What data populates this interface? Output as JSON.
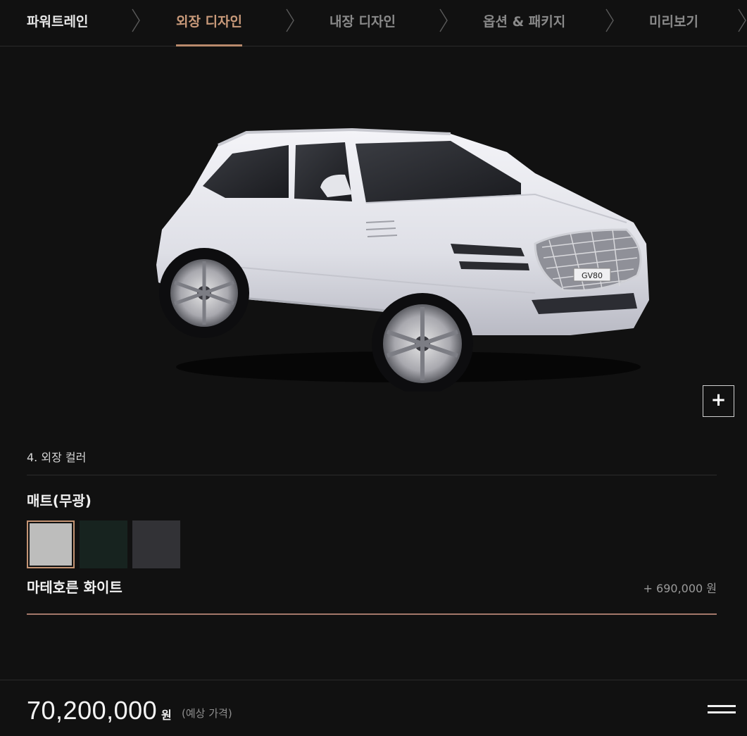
{
  "nav": {
    "steps": [
      {
        "label": "파워트레인",
        "state": "done"
      },
      {
        "label": "외장 디자인",
        "state": "active"
      },
      {
        "label": "내장 디자인",
        "state": "pending"
      },
      {
        "label": "옵션 & 패키지",
        "state": "pending"
      },
      {
        "label": "미리보기",
        "state": "pending"
      }
    ]
  },
  "car": {
    "badge": "GV80",
    "body_color": "#e7e7ec"
  },
  "zoom": {
    "label": "+"
  },
  "color_section": {
    "title": "4. 외장 컬러",
    "group_title": "매트(무광)",
    "swatches": [
      {
        "color": "#bdbdbc",
        "selected": true
      },
      {
        "color": "#17231f",
        "selected": false
      },
      {
        "color": "#323236",
        "selected": false
      }
    ],
    "selected_name": "마테호른 화이트",
    "selected_price": "+ 690,000 원"
  },
  "price": {
    "amount": "70,200,000",
    "unit": "원",
    "note": "(예상 가격)"
  },
  "colors": {
    "accent": "#b98a6c",
    "background": "#111111"
  },
  "icons": {
    "zoom": "plus-icon",
    "menu": "hamburger-menu-icon",
    "separator": "chevron-right-icon"
  }
}
